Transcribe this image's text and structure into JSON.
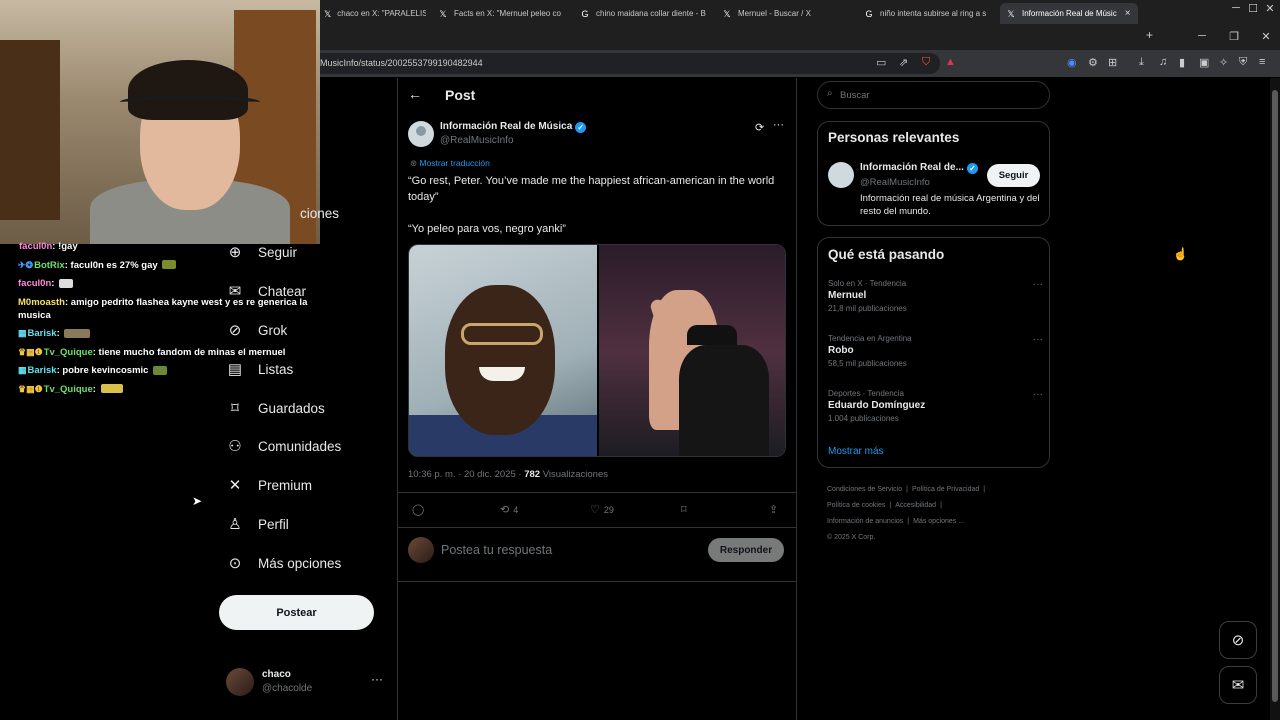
{
  "browser": {
    "tabs": [
      {
        "label": "chaco en X: \"PARALELISMOS...",
        "icon": "x"
      },
      {
        "label": "Facts en X: \"Mernuel peleo co",
        "icon": "x"
      },
      {
        "label": "chino maidana collar diente - B",
        "icon": "g"
      },
      {
        "label": "Mernuel - Buscar / X",
        "icon": "x"
      },
      {
        "label": "niño intenta subirse al ring a s",
        "icon": "g"
      },
      {
        "label": "Información Real de Músic",
        "icon": "x"
      }
    ],
    "new_tab": "+",
    "url": "MusicInfo/status/2002553799190482944",
    "window_controls": [
      "─",
      "☐",
      "✕"
    ]
  },
  "chat": [
    {
      "badges": "",
      "user": "facul0n",
      "color": "#ff8ad8",
      "text": "!gay",
      "emote": ""
    },
    {
      "badges": "✈❂",
      "user": "BotRix",
      "color": "#6ce06c",
      "text": "facul0n es 27% gay",
      "emote": "#7a8d2a"
    },
    {
      "badges": "",
      "user": "facul0n",
      "color": "#ff8ad8",
      "text": "",
      "emote": "#dddddd"
    },
    {
      "badges": "",
      "user": "M0moasth",
      "color": "#f5e26a",
      "text": "amigo pedrito flashea kayne west y es re generica la musica",
      "emote": ""
    },
    {
      "badges": "▦",
      "user": "Barisk",
      "color": "#62e0f0",
      "text": "",
      "emote": "#8a7a5a"
    },
    {
      "badges": "♛▦❶",
      "user": "Tv_Quique",
      "color": "#6ce06c",
      "text": "tiene mucho fandom de minas el mernuel",
      "emote": ""
    },
    {
      "badges": "▦",
      "user": "Barisk",
      "color": "#62e0f0",
      "text": "pobre kevincosmic",
      "emote": "#6a8a3a"
    },
    {
      "badges": "♛▦❶",
      "user": "Tv_Quique",
      "color": "#6ce06c",
      "text": "",
      "emote": "#d8c04a"
    }
  ],
  "nav": {
    "partial_item": "ciones",
    "items": [
      {
        "label": "Seguir",
        "icon": "person-add-icon",
        "glyph": "⊕"
      },
      {
        "label": "Chatear",
        "icon": "mail-icon",
        "glyph": "✉"
      },
      {
        "label": "Grok",
        "icon": "grok-icon",
        "glyph": "⊘"
      },
      {
        "label": "Listas",
        "icon": "list-icon",
        "glyph": "▤"
      },
      {
        "label": "Guardados",
        "icon": "bookmark-icon",
        "glyph": "⌑"
      },
      {
        "label": "Comunidades",
        "icon": "communities-icon",
        "glyph": "⚇"
      },
      {
        "label": "Premium",
        "icon": "x-logo-icon",
        "glyph": "✕"
      },
      {
        "label": "Perfil",
        "icon": "profile-icon",
        "glyph": "♙"
      },
      {
        "label": "Más opciones",
        "icon": "more-circle-icon",
        "glyph": "⊙"
      }
    ],
    "post_button": "Postear",
    "account": {
      "name": "chaco",
      "handle": "@chacolde"
    }
  },
  "post": {
    "header_title": "Post",
    "author_name": "Información Real de Música",
    "author_handle": "@RealMusicInfo",
    "translate_label": "Mostrar traducción",
    "text_1": "“Go rest, Peter. You’ve made me the happiest african-american in the world today”",
    "text_2": "“Yo peleo para vos, negro yanki”",
    "timestamp": "10:36 p. m. · 20 dic. 2025 ·",
    "views": "782",
    "views_label": "Visualizaciones",
    "reposts": "4",
    "likes": "29",
    "reply_placeholder": "Postea tu respuesta",
    "reply_button": "Responder"
  },
  "sidebar": {
    "search_placeholder": "Buscar",
    "relevant": {
      "title": "Personas relevantes",
      "name": "Información Real de...",
      "handle": "@RealMusicInfo",
      "bio": "Información real de música Argentina y del resto del mundo.",
      "follow": "Seguir"
    },
    "trending": {
      "title": "Qué está pasando",
      "items": [
        {
          "context": "Solo en X · Tendencia",
          "name": "Mernuel",
          "count": "21,8 mil publicaciones"
        },
        {
          "context": "Tendencia en Argentina",
          "name": "Robo",
          "count": "58,5 mil publicaciones"
        },
        {
          "context": "Deportes · Tendencia",
          "name": "Eduardo Domínguez",
          "count": "1.004 publicaciones"
        }
      ],
      "show_more": "Mostrar más"
    },
    "footer": [
      "Condiciones de Servicio",
      "|",
      "Política de Privacidad",
      "|",
      "Política de cookies",
      "|",
      "Accesibilidad",
      "|",
      "Información de anuncios",
      "|",
      "Más opciones ...",
      "© 2025 X Corp."
    ]
  },
  "colors": {
    "accent": "#1d9bf0",
    "background": "#000000",
    "border": "#2f3336",
    "muted": "#71767b"
  }
}
